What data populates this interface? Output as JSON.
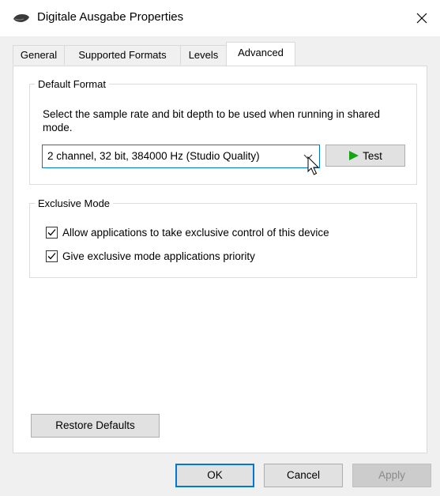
{
  "window": {
    "title": "Digitale Ausgabe Properties",
    "icon": "speaker-icon",
    "close_glyph": "✕"
  },
  "tabs": [
    {
      "label": "General",
      "active": false
    },
    {
      "label": "Supported Formats",
      "active": false
    },
    {
      "label": "Levels",
      "active": false
    },
    {
      "label": "Advanced",
      "active": true
    }
  ],
  "default_format": {
    "legend": "Default Format",
    "description": "Select the sample rate and bit depth to be used when running in shared mode.",
    "selected_format": "2 channel, 32 bit, 384000 Hz (Studio Quality)",
    "test_button": "Test"
  },
  "exclusive_mode": {
    "legend": "Exclusive Mode",
    "options": [
      {
        "label": "Allow applications to take exclusive control of this device",
        "checked": true
      },
      {
        "label": "Give exclusive mode applications priority",
        "checked": true
      }
    ]
  },
  "restore_defaults": "Restore Defaults",
  "footer": {
    "ok": "OK",
    "cancel": "Cancel",
    "apply": "Apply"
  },
  "colors": {
    "accent": "#0078d7",
    "play_green": "#16a316",
    "panel_bg": "#ffffff",
    "dialog_bg": "#f0f0f0"
  }
}
